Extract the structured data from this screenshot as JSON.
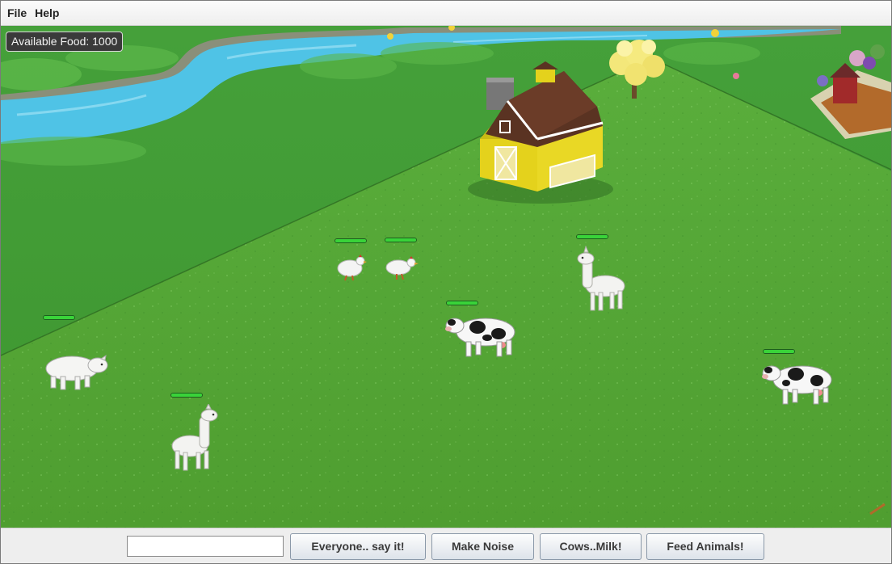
{
  "menubar": {
    "file": "File",
    "help": "Help"
  },
  "hud": {
    "available_food": "Available Food: 1000"
  },
  "animals": [
    {
      "kind": "chicken",
      "health": 1.0
    },
    {
      "kind": "chicken",
      "health": 1.0
    },
    {
      "kind": "llama",
      "health": 1.0
    },
    {
      "kind": "cow",
      "health": 1.0
    },
    {
      "kind": "sheep",
      "health": 1.0
    },
    {
      "kind": "llama",
      "health": 1.0
    },
    {
      "kind": "cow",
      "health": 1.0
    }
  ],
  "controls": {
    "say_input_value": "",
    "say_button": "Everyone.. say it!",
    "noise_button": "Make Noise",
    "milk_button": "Cows..Milk!",
    "feed_button": "Feed Animals!"
  },
  "colors": {
    "grass": "#4fa43a",
    "grass_dark": "#3e8f2c",
    "water": "#4fc3e6",
    "barn_yellow": "#e4d21c",
    "barn_roof": "#5a3322",
    "health": "#39d339"
  }
}
